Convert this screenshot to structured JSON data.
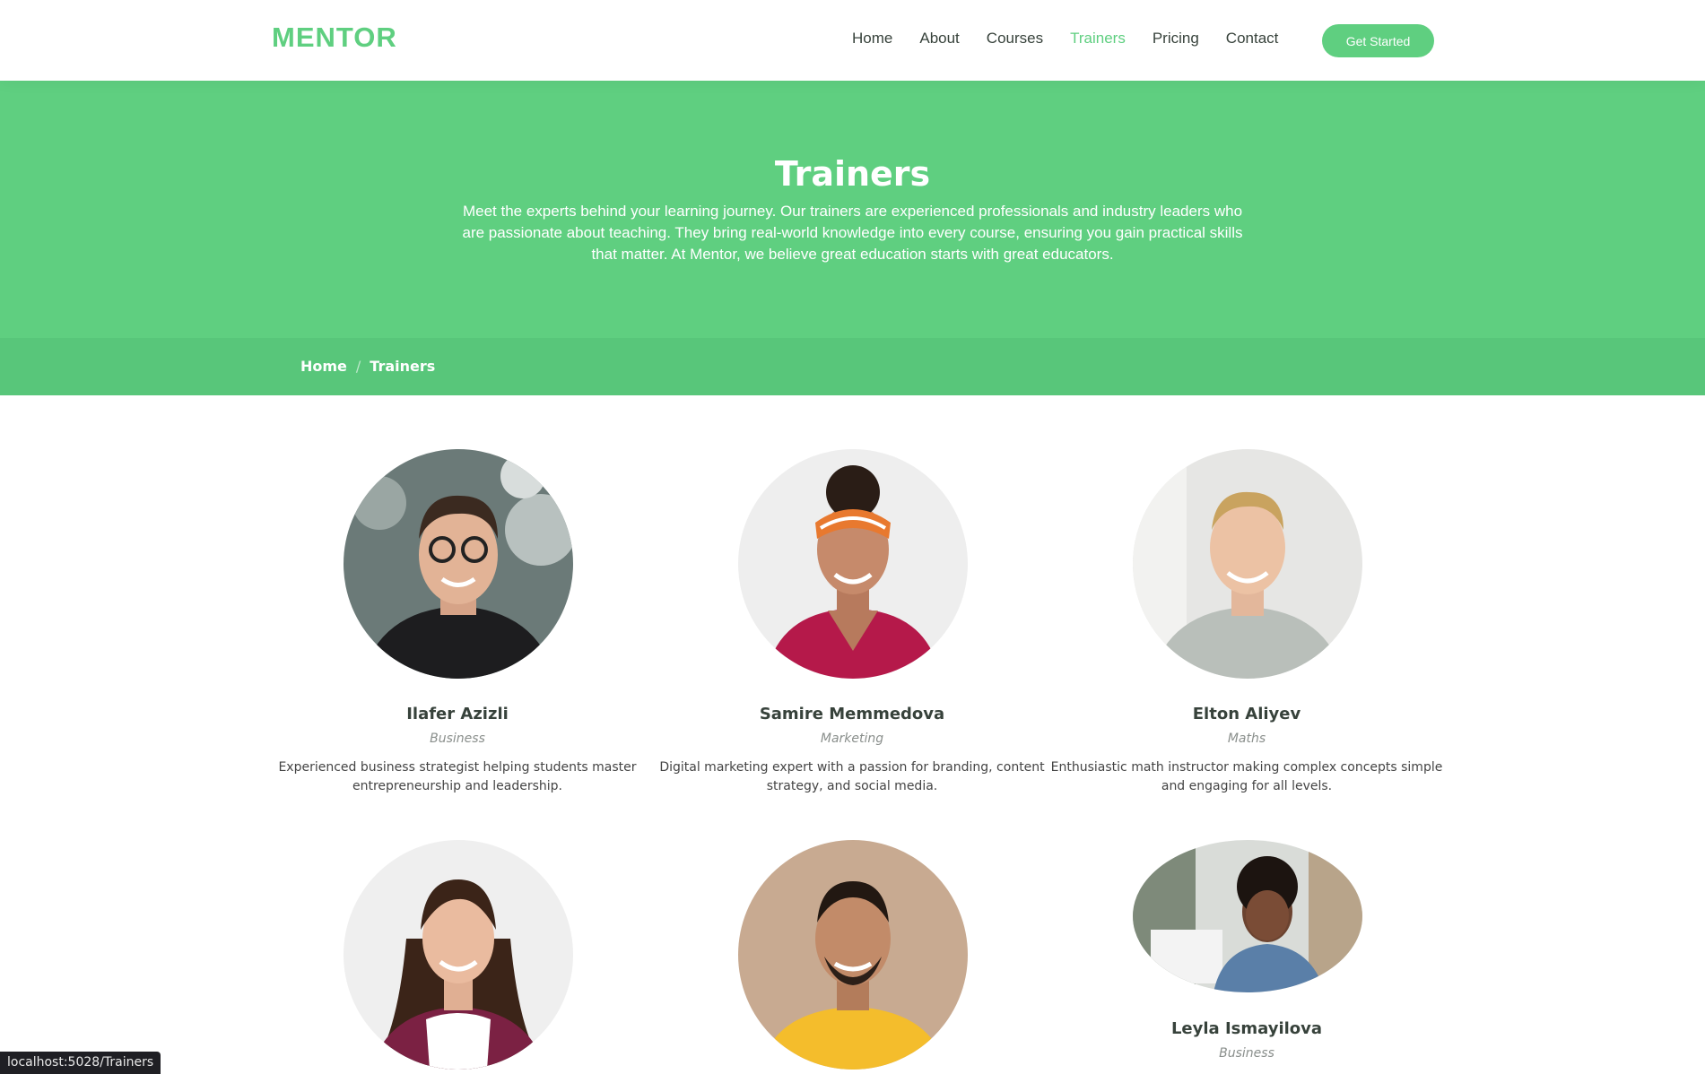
{
  "header": {
    "logo": "MENTOR",
    "nav": [
      "Home",
      "About",
      "Courses",
      "Trainers",
      "Pricing",
      "Contact"
    ],
    "active_nav": "Trainers",
    "cta_label": "Get Started"
  },
  "hero": {
    "title": "Trainers",
    "text": "Meet the experts behind your learning journey. Our trainers are experienced professionals and industry leaders who are passionate about teaching. They bring real-world knowledge into every course, ensuring you gain practical skills that matter. At Mentor, we believe great education starts with great educators."
  },
  "breadcrumb": {
    "home": "Home",
    "separator": "/",
    "current": "Trainers"
  },
  "trainers": [
    {
      "name": "Ilafer Azizli",
      "role": "Business",
      "description": "Experienced business strategist helping students master entrepreneurship and leadership."
    },
    {
      "name": "Samire Memmedova",
      "role": "Marketing",
      "description": "Digital marketing expert with a passion for branding, content strategy, and social media."
    },
    {
      "name": "Elton Aliyev",
      "role": "Maths",
      "description": "Enthusiastic math instructor making complex concepts simple and engaging for all levels."
    },
    {
      "name": "",
      "role": "",
      "description": ""
    },
    {
      "name": "",
      "role": "",
      "description": ""
    },
    {
      "name": "Leyla Ismayilova",
      "role": "Business",
      "description": ""
    }
  ],
  "status_bar": "localhost:5028/Trainers",
  "colors": {
    "accent": "#5fcf80",
    "breadcrumb_bg": "#58c67a",
    "text": "#37423b"
  }
}
